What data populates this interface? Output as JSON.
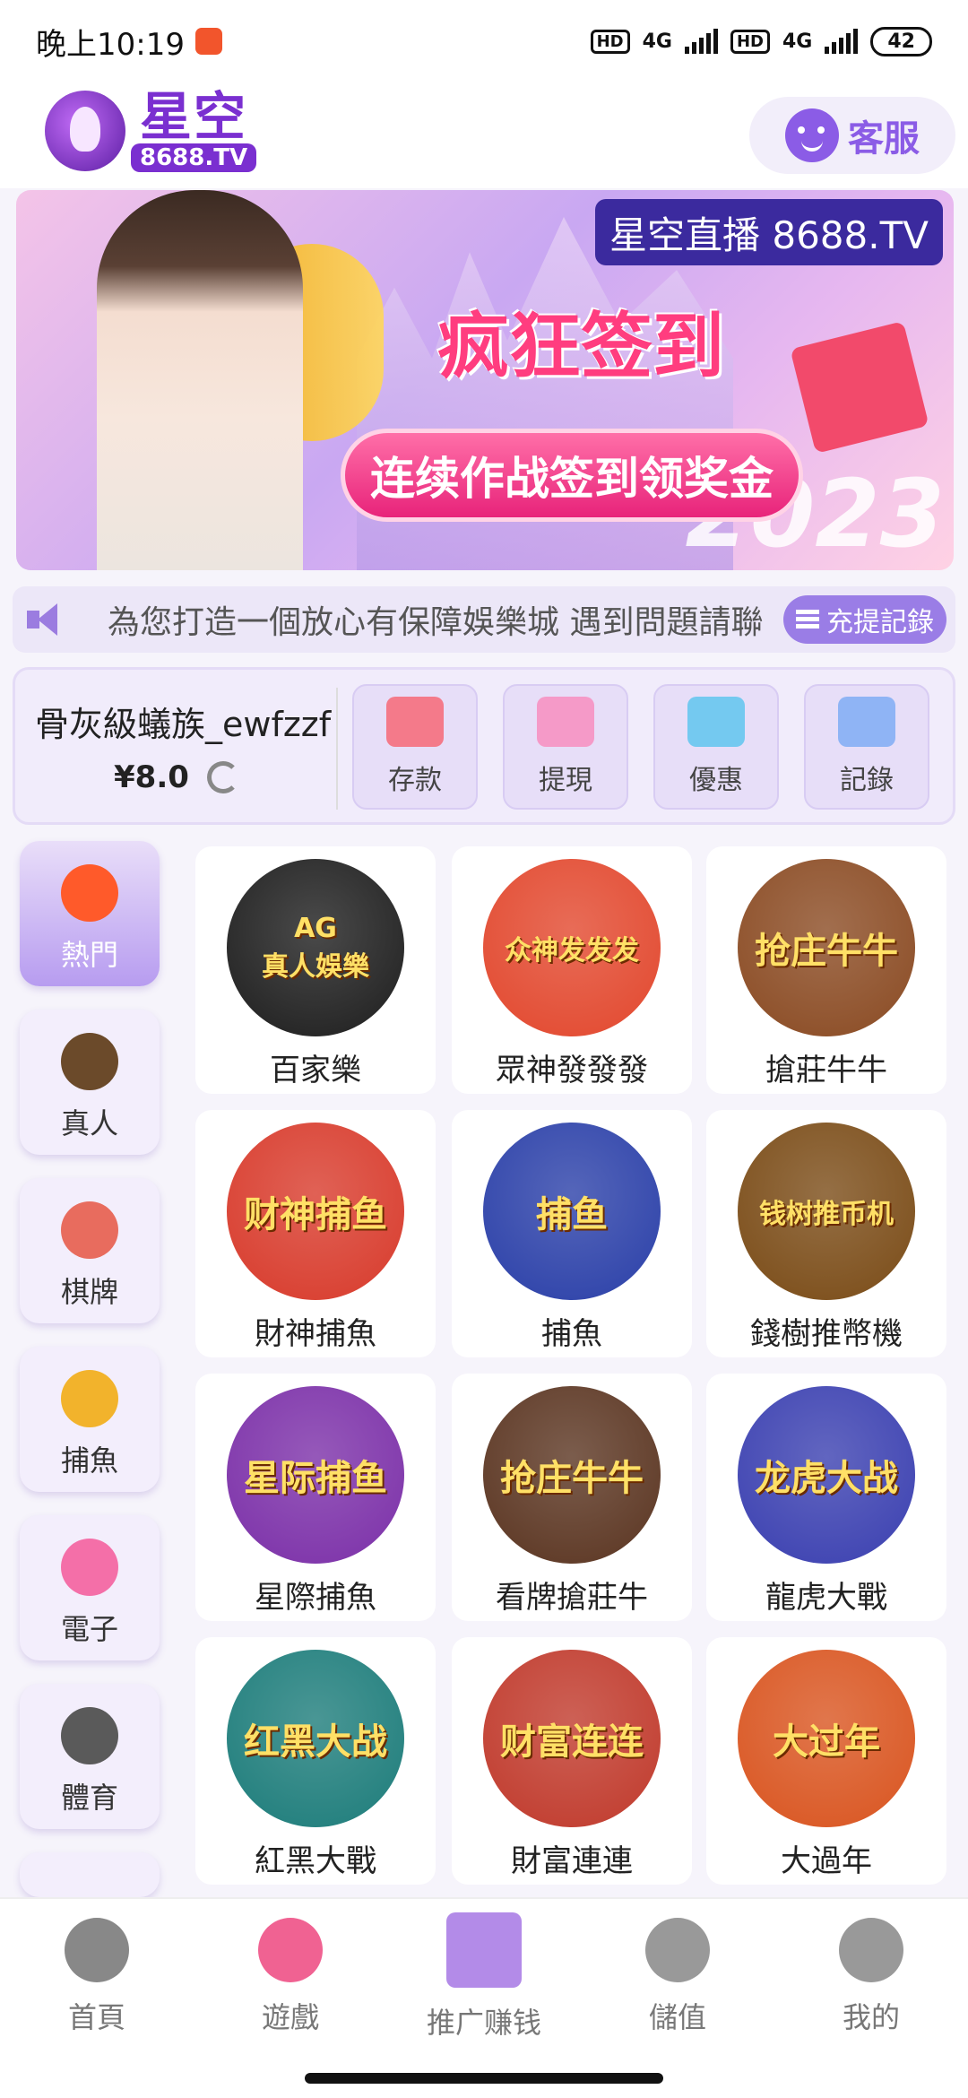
{
  "status_bar": {
    "time": "晚上10:19",
    "net1": "4G",
    "net2": "4G",
    "hd1": "HD",
    "hd2": "HD",
    "battery": "42"
  },
  "header": {
    "logo_text": "星空",
    "logo_url": "8688.TV",
    "service_label": "客服"
  },
  "banner": {
    "tag": "星空直播 8688.TV",
    "title": "疯狂签到",
    "pill": "连续作战签到领奖金",
    "year": "2023"
  },
  "notice": {
    "text": "為您打造一個放心有保障娛樂城  遇到問題請聯",
    "record_label": "充提記錄"
  },
  "user": {
    "name": "骨灰級蟻族_ewfzzf",
    "balance": "¥8.0",
    "actions": [
      {
        "label": "存款",
        "icon": "card-icon",
        "color": "#f47a8a"
      },
      {
        "label": "提現",
        "icon": "money-bag-icon",
        "color": "#f59ac8"
      },
      {
        "label": "優惠",
        "icon": "gift-icon",
        "color": "#74c9f0"
      },
      {
        "label": "記錄",
        "icon": "bar-chart-icon",
        "color": "#8fb4f5"
      }
    ]
  },
  "categories": [
    {
      "label": "熱門",
      "icon": "fire-icon",
      "active": true
    },
    {
      "label": "真人",
      "icon": "casino-chip-icon",
      "active": false
    },
    {
      "label": "棋牌",
      "icon": "card-icon",
      "active": false
    },
    {
      "label": "捕魚",
      "icon": "fish-icon",
      "active": false
    },
    {
      "label": "電子",
      "icon": "slot-icon",
      "active": false
    },
    {
      "label": "體育",
      "icon": "soccer-ball-icon",
      "active": false
    }
  ],
  "games": [
    {
      "name": "百家樂",
      "art": "AG\n真人娛樂",
      "bg": "#1d1d1d"
    },
    {
      "name": "眾神發發發",
      "art": "众神发发发",
      "bg": "#e2472d"
    },
    {
      "name": "搶莊牛牛",
      "art": "抢庄牛牛",
      "bg": "#8a4a22"
    },
    {
      "name": "財神捕魚",
      "art": "财神捕鱼",
      "bg": "#d83a2b"
    },
    {
      "name": "捕魚",
      "art": "捕鱼",
      "bg": "#2a3fa8"
    },
    {
      "name": "錢樹推幣機",
      "art": "钱树推币机",
      "bg": "#7a4b16"
    },
    {
      "name": "星際捕魚",
      "art": "星际捕鱼",
      "bg": "#7b2fa8"
    },
    {
      "name": "看牌搶莊牛",
      "art": "抢庄牛牛",
      "bg": "#5a3420"
    },
    {
      "name": "龍虎大戰",
      "art": "龙虎大战",
      "bg": "#3a3fb0"
    },
    {
      "name": "紅黑大戰",
      "art": "红黑大战",
      "bg": "#1c7c7a"
    },
    {
      "name": "財富連連",
      "art": "财富连连",
      "bg": "#c0392b"
    },
    {
      "name": "大過年",
      "art": "大过年",
      "bg": "#d9541f"
    }
  ],
  "bottom_nav": [
    {
      "label": "首頁",
      "icon": "home-girl-icon",
      "color": "#888"
    },
    {
      "label": "遊戲",
      "icon": "gamepad-icon",
      "color": "#f06292"
    },
    {
      "label": "推广赚钱",
      "icon": "promo-box-icon",
      "color": "#b38be8"
    },
    {
      "label": "儲值",
      "icon": "yuan-icon",
      "color": "#999"
    },
    {
      "label": "我的",
      "icon": "user-icon",
      "color": "#999"
    }
  ]
}
